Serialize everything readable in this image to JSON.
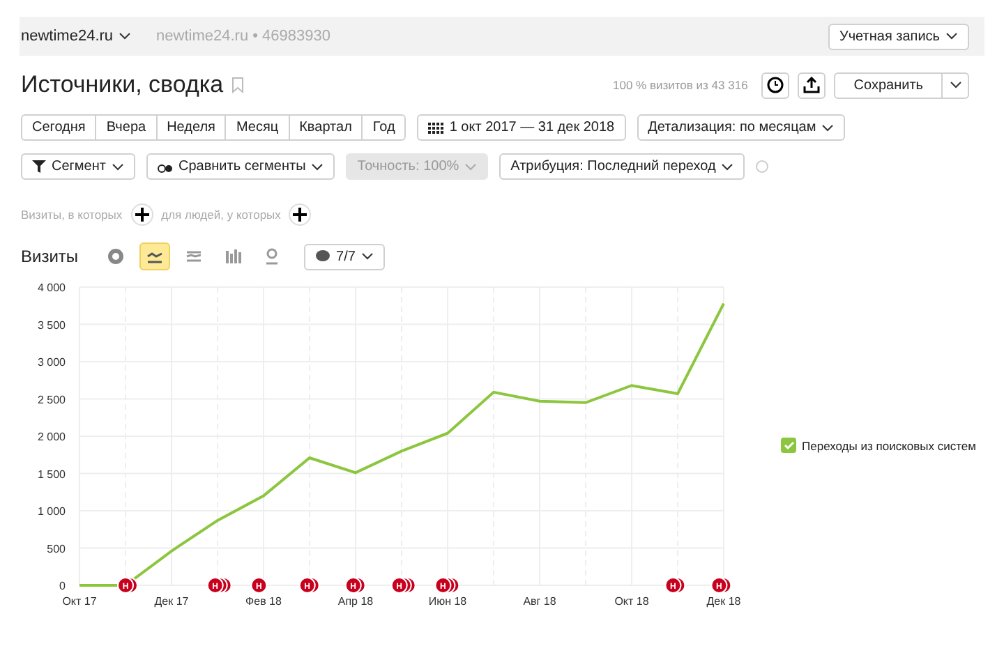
{
  "top_bar": {
    "site": "newtime24.ru",
    "counter": "newtime24.ru • 46983930",
    "account_button": "Учетная запись"
  },
  "header": {
    "title": "Источники, сводка",
    "visits_share": "100 % визитов из 43 316",
    "save_button": "Сохранить"
  },
  "periods": [
    {
      "label": "Сегодня",
      "selected": false
    },
    {
      "label": "Вчера",
      "selected": false
    },
    {
      "label": "Неделя",
      "selected": false
    },
    {
      "label": "Месяц",
      "selected": false
    },
    {
      "label": "Квартал",
      "selected": false
    },
    {
      "label": "Год",
      "selected": false
    }
  ],
  "date_range": "1 окт 2017 — 31 дек 2018",
  "detail": "Детализация: по месяцам",
  "filters": [
    {
      "label": "Сегмент",
      "disabled": false
    },
    {
      "label": "Сравнить сегменты",
      "disabled": false
    },
    {
      "label": "Точность: 100%",
      "disabled": true
    },
    {
      "label": "Атрибуция: Последний переход",
      "disabled": false
    }
  ],
  "conditions": [
    "Визиты, в которых",
    "для людей, у которых"
  ],
  "chart_section": {
    "title": "Визиты",
    "chart_types": [
      {
        "kind": "pie",
        "selected": false
      },
      {
        "kind": "line",
        "selected": true
      },
      {
        "kind": "area",
        "selected": false
      },
      {
        "kind": "bar",
        "selected": false
      },
      {
        "kind": "map",
        "selected": false
      }
    ],
    "notes_button": "7/7",
    "chart_data": {
      "type": "line",
      "grid": true,
      "categories": [
        "Окт 17",
        null,
        "Дек 17",
        null,
        "Фев 18",
        null,
        "Апр 18",
        null,
        "Июн 18",
        null,
        "Авг 18",
        null,
        "Окт 18",
        null,
        "Дек 18"
      ],
      "series": [
        {
          "name": "Переходы из поисковых систем",
          "color": "#8cc63f",
          "values": [
            0,
            0,
            460,
            870,
            1200,
            1710,
            1510,
            1800,
            2040,
            2590,
            2470,
            2450,
            2680,
            2570,
            3780
          ]
        }
      ],
      "ylim": [
        0,
        4000
      ],
      "yticks": [
        {
          "value": 0,
          "label": "0"
        },
        {
          "value": 500,
          "label": "500"
        },
        {
          "value": 1000,
          "label": "1 000"
        },
        {
          "value": 1500,
          "label": "1 500"
        },
        {
          "value": 2000,
          "label": "2 000"
        },
        {
          "value": 2500,
          "label": "2 500"
        },
        {
          "value": 3000,
          "label": "3 000"
        },
        {
          "value": 3500,
          "label": "3 500"
        },
        {
          "value": 4000,
          "label": "4 000"
        }
      ]
    },
    "note_markers": [
      {
        "label": "Н"
      },
      {
        "label": "Н"
      },
      {
        "label": "Н"
      },
      {
        "label": "Н"
      },
      {
        "label": "Н"
      },
      {
        "label": "Н"
      },
      {
        "label": "Н"
      },
      {
        "label": "Н"
      },
      {
        "label": "Н"
      }
    ],
    "legend": [
      {
        "checked": true
      }
    ]
  }
}
